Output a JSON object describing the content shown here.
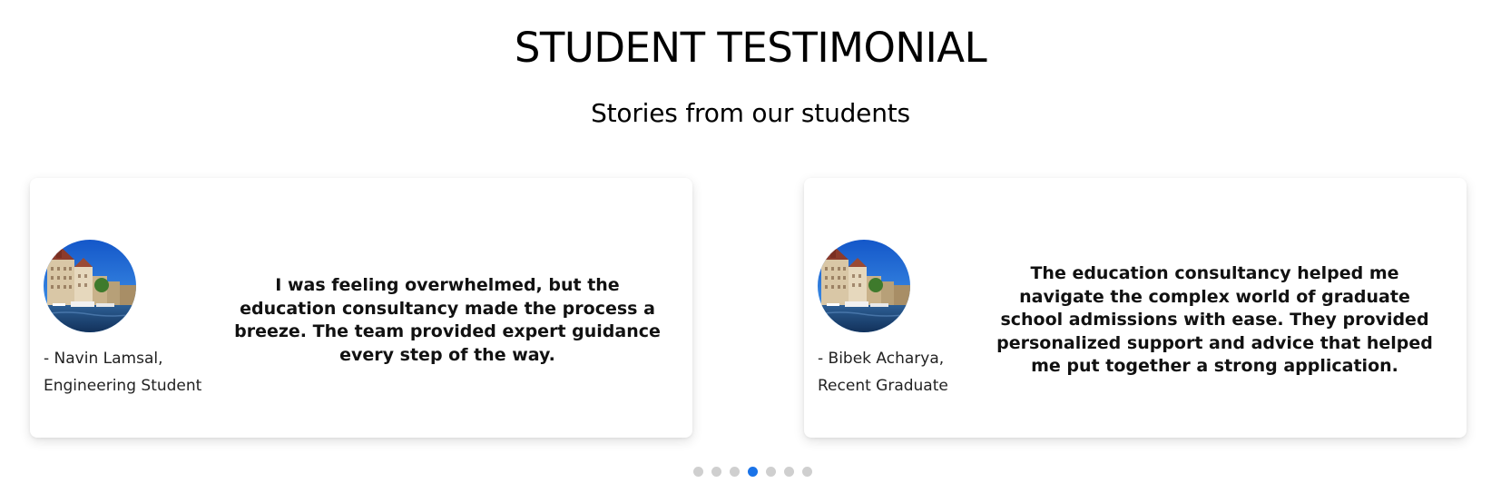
{
  "section": {
    "title": "STUDENT TESTIMONIAL",
    "subtitle": "Stories from our students"
  },
  "testimonials": [
    {
      "quote": "I was feeling overwhelmed, but the education consultancy made the process a breeze. The team provided expert guidance every step of the way.",
      "author_name": "- Navin Lamsal,",
      "author_role": "Engineering Student",
      "avatar_icon": "city-canal-photo"
    },
    {
      "quote": "The education consultancy helped me navigate the complex world of graduate school admissions with ease. They provided personalized support and advice that helped me put together a strong application.",
      "author_name": "- Bibek Acharya,",
      "author_role": "Recent Graduate",
      "avatar_icon": "city-canal-photo"
    }
  ],
  "pagination": {
    "total": 7,
    "active_index": 3
  },
  "colors": {
    "dot_active": "#1a73e8",
    "dot_inactive": "#cfcfcf"
  }
}
